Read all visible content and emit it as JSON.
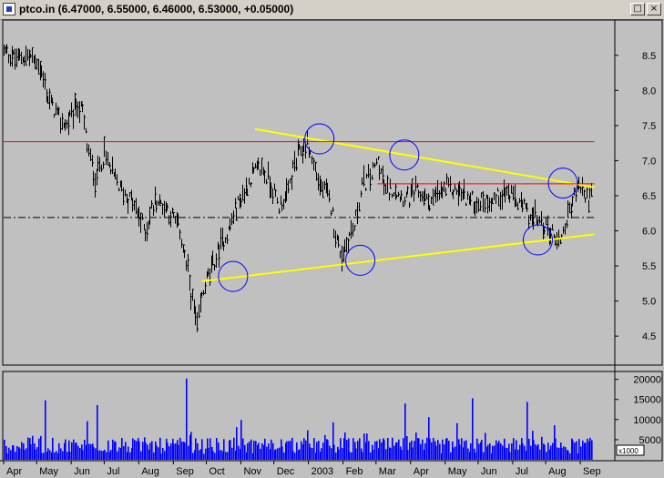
{
  "window": {
    "title": "ptco.in (6.47000, 6.55000, 6.46000, 6.53000, +0.05000)",
    "maximize_glyph": "□",
    "close_glyph": "×",
    "icons": [
      "app-icon",
      "maximize-icon",
      "close-icon"
    ]
  },
  "colors": {
    "background": "#c0c0c0",
    "price_bar": "#000000",
    "volume_bar": "#0000ff",
    "trendline": "#ffff00",
    "resistance": "#ff0000",
    "circle": "#0000ff"
  },
  "chart_data": [
    {
      "type": "ohlc",
      "title": "ptco.in (6.47000, 6.55000, 6.46000, 6.53000, +0.05000)",
      "last": {
        "open": 6.47,
        "high": 6.55,
        "low": 6.46,
        "close": 6.53,
        "change": 0.05
      },
      "x_ticks": [
        "Apr",
        "May",
        "Jun",
        "Jul",
        "Aug",
        "Sep",
        "Oct",
        "Nov",
        "Dec",
        "2003",
        "Feb",
        "Mar",
        "Apr",
        "May",
        "Jun",
        "Jul",
        "Aug",
        "Sep"
      ],
      "x_tick_index": [
        0,
        21,
        43,
        64,
        86,
        108,
        129,
        151,
        172,
        194,
        216,
        237,
        259,
        281,
        302,
        324,
        345,
        367
      ],
      "x_range": [
        0,
        389
      ],
      "y_ticks": [
        "8.5",
        "8.0",
        "7.5",
        "7.0",
        "6.5",
        "6.0",
        "5.5",
        "5.0",
        "4.5"
      ],
      "ylim": [
        4.1,
        8.99
      ],
      "series": [
        {
          "type": "line",
          "x": [
            0,
            8,
            15,
            22,
            28,
            35,
            40,
            46,
            50,
            53,
            58,
            64,
            68,
            74,
            82,
            90,
            96,
            103,
            107,
            112,
            117,
            120,
            123,
            126,
            129,
            133,
            137,
            143,
            148,
            153,
            158,
            164,
            170,
            175,
            180,
            185,
            189,
            193,
            197,
            201,
            205,
            208,
            211,
            215,
            219,
            223,
            228,
            233,
            238,
            243,
            248,
            253,
            258,
            262,
            266,
            270,
            276,
            282,
            290,
            300,
            310,
            320,
            330,
            336,
            340,
            345,
            350,
            353,
            356,
            360,
            364,
            367,
            370,
            374
          ],
          "values": [
            8.55,
            8.45,
            8.5,
            8.4,
            7.9,
            7.6,
            7.5,
            7.8,
            7.7,
            7.2,
            6.75,
            7.1,
            6.85,
            6.6,
            6.4,
            6.0,
            6.45,
            6.35,
            6.2,
            6.0,
            5.4,
            5.0,
            4.6,
            5.05,
            5.3,
            5.5,
            5.75,
            6.0,
            6.35,
            6.55,
            6.8,
            6.9,
            6.65,
            6.35,
            6.5,
            6.95,
            7.15,
            7.25,
            6.95,
            6.65,
            6.55,
            6.35,
            5.95,
            5.65,
            5.9,
            6.05,
            6.65,
            6.75,
            7.0,
            6.55,
            6.6,
            6.5,
            6.45,
            6.55,
            6.5,
            6.4,
            6.5,
            6.6,
            6.55,
            6.4,
            6.45,
            6.55,
            6.35,
            6.2,
            6.15,
            6.05,
            5.95,
            5.85,
            6.0,
            6.3,
            6.55,
            6.65,
            6.45,
            6.5
          ]
        },
        {
          "type": "line",
          "name": "",
          "color": "#ffff00",
          "x": [
            160,
            376
          ],
          "values": [
            7.45,
            6.62
          ]
        },
        {
          "type": "line",
          "name": "",
          "color": "#ffff00",
          "x": [
            126,
            376
          ],
          "values": [
            5.28,
            5.95
          ]
        },
        {
          "type": "hline",
          "color": "#ff0000",
          "y": 7.27,
          "x": [
            0,
            376
          ]
        },
        {
          "type": "hline",
          "color": "#ff0000",
          "y": 6.67,
          "x": [
            238,
            376
          ]
        },
        {
          "type": "hline",
          "style": "dash-dot",
          "color": "#000000",
          "y": 6.19,
          "x": [
            0,
            376
          ]
        }
      ],
      "annotations": [
        {
          "type": "circle",
          "x": 146,
          "y": 5.35
        },
        {
          "type": "circle",
          "x": 201,
          "y": 7.31
        },
        {
          "type": "circle",
          "x": 227,
          "y": 5.58
        },
        {
          "type": "circle",
          "x": 255,
          "y": 7.08
        },
        {
          "type": "circle",
          "x": 340,
          "y": 5.87
        },
        {
          "type": "circle",
          "x": 356,
          "y": 6.68
        }
      ],
      "grid": false,
      "legend": "none"
    },
    {
      "type": "bar",
      "x_range": [
        0,
        389
      ],
      "y_ticks": [
        "20000",
        "15000",
        "10000",
        "5000"
      ],
      "y_tick_values": [
        20000,
        15000,
        10000,
        5000
      ],
      "unit_label": "x1000",
      "ylim": [
        0,
        21500
      ],
      "spikes": [
        {
          "x": 26,
          "value": 14800
        },
        {
          "x": 53,
          "value": 9600
        },
        {
          "x": 59,
          "value": 13600
        },
        {
          "x": 116,
          "value": 20200
        },
        {
          "x": 151,
          "value": 9900
        },
        {
          "x": 209,
          "value": 9300
        },
        {
          "x": 217,
          "value": 6800
        },
        {
          "x": 255,
          "value": 14000
        },
        {
          "x": 270,
          "value": 10600
        },
        {
          "x": 288,
          "value": 9100
        },
        {
          "x": 298,
          "value": 15300
        },
        {
          "x": 333,
          "value": 14400
        },
        {
          "x": 350,
          "value": 8600
        }
      ],
      "baseline_range": [
        1500,
        5500
      ],
      "color": "#0000ff"
    }
  ]
}
